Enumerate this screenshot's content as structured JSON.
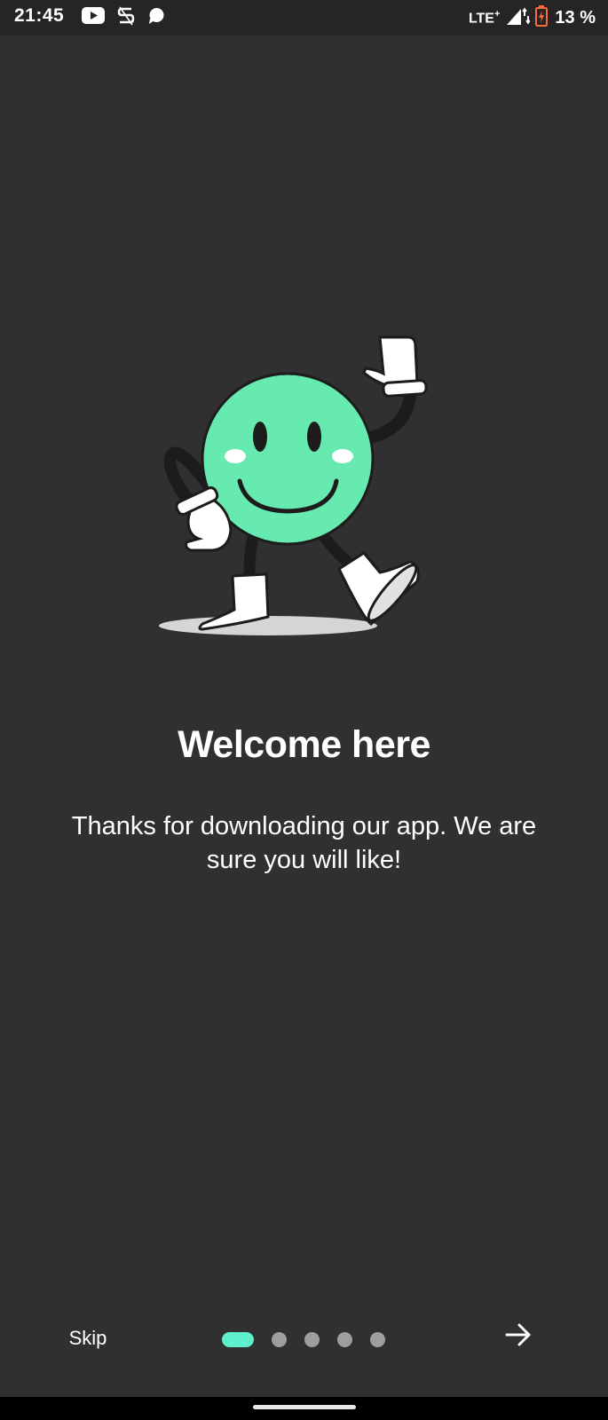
{
  "status_bar": {
    "time": "21:45",
    "network": "LTE",
    "network_plus": "+",
    "battery": "13 %",
    "icons": [
      "youtube-icon",
      "s-app-icon",
      "chat-bubble-icon",
      "signal-icon",
      "battery-icon"
    ]
  },
  "illustration": {
    "name": "waving-smiley-mascot",
    "face_color": "#66eab0",
    "glove_color": "#ffffff",
    "shadow_color": "#d5d5d5"
  },
  "onboarding": {
    "title": "Welcome here",
    "subtitle": "Thanks for downloading our app. We are sure you will like!"
  },
  "nav": {
    "skip_label": "Skip",
    "page_count": 5,
    "active_page": 1,
    "next_icon": "arrow-right-icon",
    "accent_color": "#5ef0cd"
  }
}
